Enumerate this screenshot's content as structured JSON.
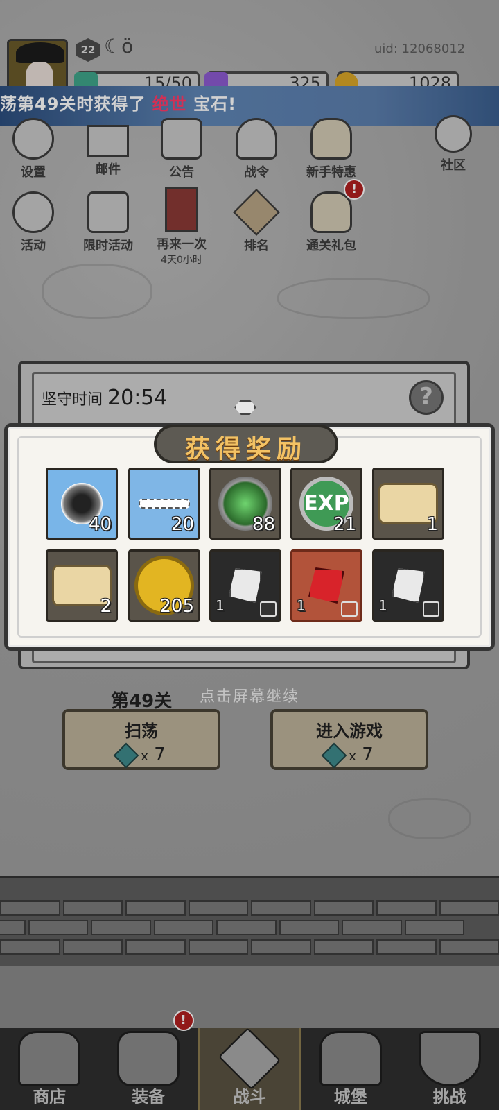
{
  "header": {
    "level": "22",
    "uid": "uid: 12068012",
    "resources": [
      {
        "name": "energy",
        "value": "15/50",
        "color": "#3fa58a"
      },
      {
        "name": "purple-gem",
        "value": "325",
        "color": "#8d5bd1"
      },
      {
        "name": "gold-coin",
        "value": "1028",
        "color": "#d9a628"
      }
    ]
  },
  "banner": {
    "prefix": "荡第49关时获得了 ",
    "highlight": "绝世",
    "suffix": " 宝石!"
  },
  "menu": {
    "row1": [
      {
        "label": "设置",
        "icon": "gear-icon"
      },
      {
        "label": "邮件",
        "icon": "mail-icon"
      },
      {
        "label": "公告",
        "icon": "scroll-icon"
      },
      {
        "label": "战令",
        "icon": "battle-pass-icon"
      },
      {
        "label": "新手特惠",
        "icon": "bag-icon"
      },
      {
        "label": "社区",
        "icon": "home-icon"
      }
    ],
    "row2": [
      {
        "label": "活动",
        "icon": "wreath-icon"
      },
      {
        "label": "限时活动",
        "icon": "hourglass-icon"
      },
      {
        "label": "再来一次",
        "sub": "4天0小时",
        "icon": "card-icon"
      },
      {
        "label": "排名",
        "icon": "ranking-icon"
      },
      {
        "label": "通关礼包",
        "icon": "gift-bag-icon",
        "badge": "!"
      }
    ]
  },
  "stage": {
    "time_label": "坚守时间",
    "time_value": "20:54",
    "help": "?",
    "name": "第49关",
    "continue_hint": "点击屏幕继续",
    "sweep": {
      "label": "扫荡",
      "cost_mult": "x",
      "cost": "7"
    },
    "enter": {
      "label": "进入游戏",
      "cost_mult": "x",
      "cost": "7"
    }
  },
  "popup": {
    "title": "获得奖励",
    "rewards": [
      {
        "icon": "dark-crystal-icon",
        "count": "40"
      },
      {
        "icon": "ice-crystal-icon",
        "count": "20"
      },
      {
        "icon": "green-emblem-icon",
        "count": "88"
      },
      {
        "icon": "exp-icon",
        "count": "21",
        "label": "EXP"
      },
      {
        "icon": "scroll-icon",
        "count": "1"
      },
      {
        "icon": "scroll-icon",
        "count": "2"
      },
      {
        "icon": "gold-coin-icon",
        "count": "205"
      },
      {
        "icon": "white-gem-icon",
        "count": "1"
      },
      {
        "icon": "red-gem-icon",
        "count": "1"
      },
      {
        "icon": "white-gem-icon",
        "count": "1"
      }
    ]
  },
  "nav": [
    {
      "label": "商店",
      "icon": "shop-icon"
    },
    {
      "label": "装备",
      "icon": "backpack-icon",
      "badge": "!"
    },
    {
      "label": "战斗",
      "icon": "crossed-swords-icon",
      "active": true
    },
    {
      "label": "城堡",
      "icon": "castle-icon"
    },
    {
      "label": "挑战",
      "icon": "shield-icon"
    }
  ]
}
